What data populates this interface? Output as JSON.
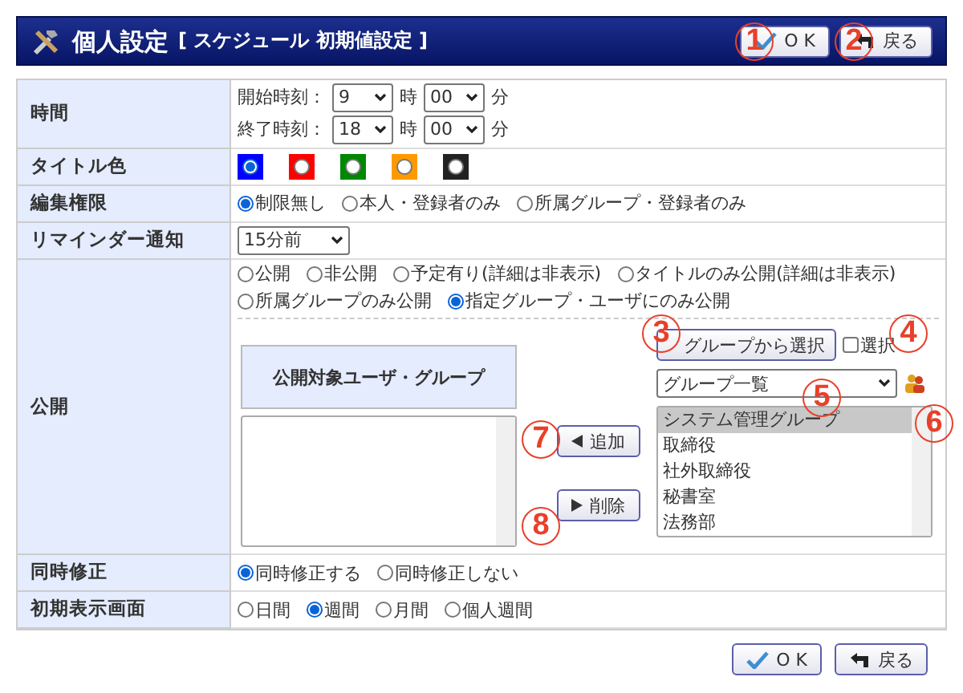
{
  "header": {
    "title": "個人設定",
    "subtitle": "[ スケジュール  初期値設定 ]",
    "buttons": [
      {
        "kind": "ok",
        "label": "O K"
      },
      {
        "kind": "back",
        "label": "戻る"
      }
    ]
  },
  "rows": [
    {
      "kind": "time",
      "label": "時間",
      "lines": [
        {
          "caption": "開始時刻：",
          "hour": "9",
          "hour_unit": "時",
          "minute": "00",
          "minute_unit": "分"
        },
        {
          "caption": "終了時刻：",
          "hour": "18",
          "hour_unit": "時",
          "minute": "00",
          "minute_unit": "分"
        }
      ]
    },
    {
      "kind": "colors",
      "label": "タイトル色",
      "options": [
        {
          "color": "#0000ff",
          "selected": true
        },
        {
          "color": "#ff0000",
          "selected": false
        },
        {
          "color": "#008800",
          "selected": false
        },
        {
          "color": "#ff9900",
          "selected": false
        },
        {
          "color": "#222222",
          "selected": false
        }
      ]
    },
    {
      "kind": "radios",
      "label": "編集権限",
      "options": [
        {
          "label": "制限無し",
          "selected": true
        },
        {
          "label": "本人・登録者のみ",
          "selected": false
        },
        {
          "label": "所属グループ・登録者のみ",
          "selected": false
        }
      ]
    },
    {
      "kind": "select",
      "label": "リマインダー通知",
      "value": "15分前"
    },
    {
      "kind": "publish",
      "label": "公開",
      "options": [
        {
          "label": "公開",
          "selected": false
        },
        {
          "label": "非公開",
          "selected": false
        },
        {
          "label": "予定有り(詳細は非表示)",
          "selected": false
        },
        {
          "label": "タイトルのみ公開(詳細は非表示)",
          "selected": false
        },
        {
          "label": "所属グループのみ公開",
          "selected": false
        },
        {
          "label": "指定グループ・ユーザにのみ公開",
          "selected": true
        }
      ],
      "target_heading": "公開対象ユーザ・グループ",
      "add_button": "追加",
      "remove_button": "削除",
      "group_select_button": "グループから選択",
      "select_checkbox": {
        "label": "選択",
        "checked": false
      },
      "group_dropdown": "グループ一覧",
      "groups": [
        {
          "label": "システム管理グループ",
          "selected": true
        },
        {
          "label": "取締役",
          "selected": false
        },
        {
          "label": "社外取締役",
          "selected": false
        },
        {
          "label": "秘書室",
          "selected": false
        },
        {
          "label": "法務部",
          "selected": false
        }
      ]
    },
    {
      "kind": "radios",
      "label": "同時修正",
      "options": [
        {
          "label": "同時修正する",
          "selected": true
        },
        {
          "label": "同時修正しない",
          "selected": false
        }
      ]
    },
    {
      "kind": "radios",
      "label": "初期表示画面",
      "options": [
        {
          "label": "日間",
          "selected": false
        },
        {
          "label": "週間",
          "selected": true
        },
        {
          "label": "月間",
          "selected": false
        },
        {
          "label": "個人週間",
          "selected": false
        }
      ]
    }
  ],
  "footer_buttons": [
    {
      "kind": "ok",
      "label": "O K"
    },
    {
      "kind": "back",
      "label": "戻る"
    }
  ],
  "callouts": [
    "1",
    "2",
    "3",
    "4",
    "5",
    "6",
    "7",
    "8"
  ]
}
